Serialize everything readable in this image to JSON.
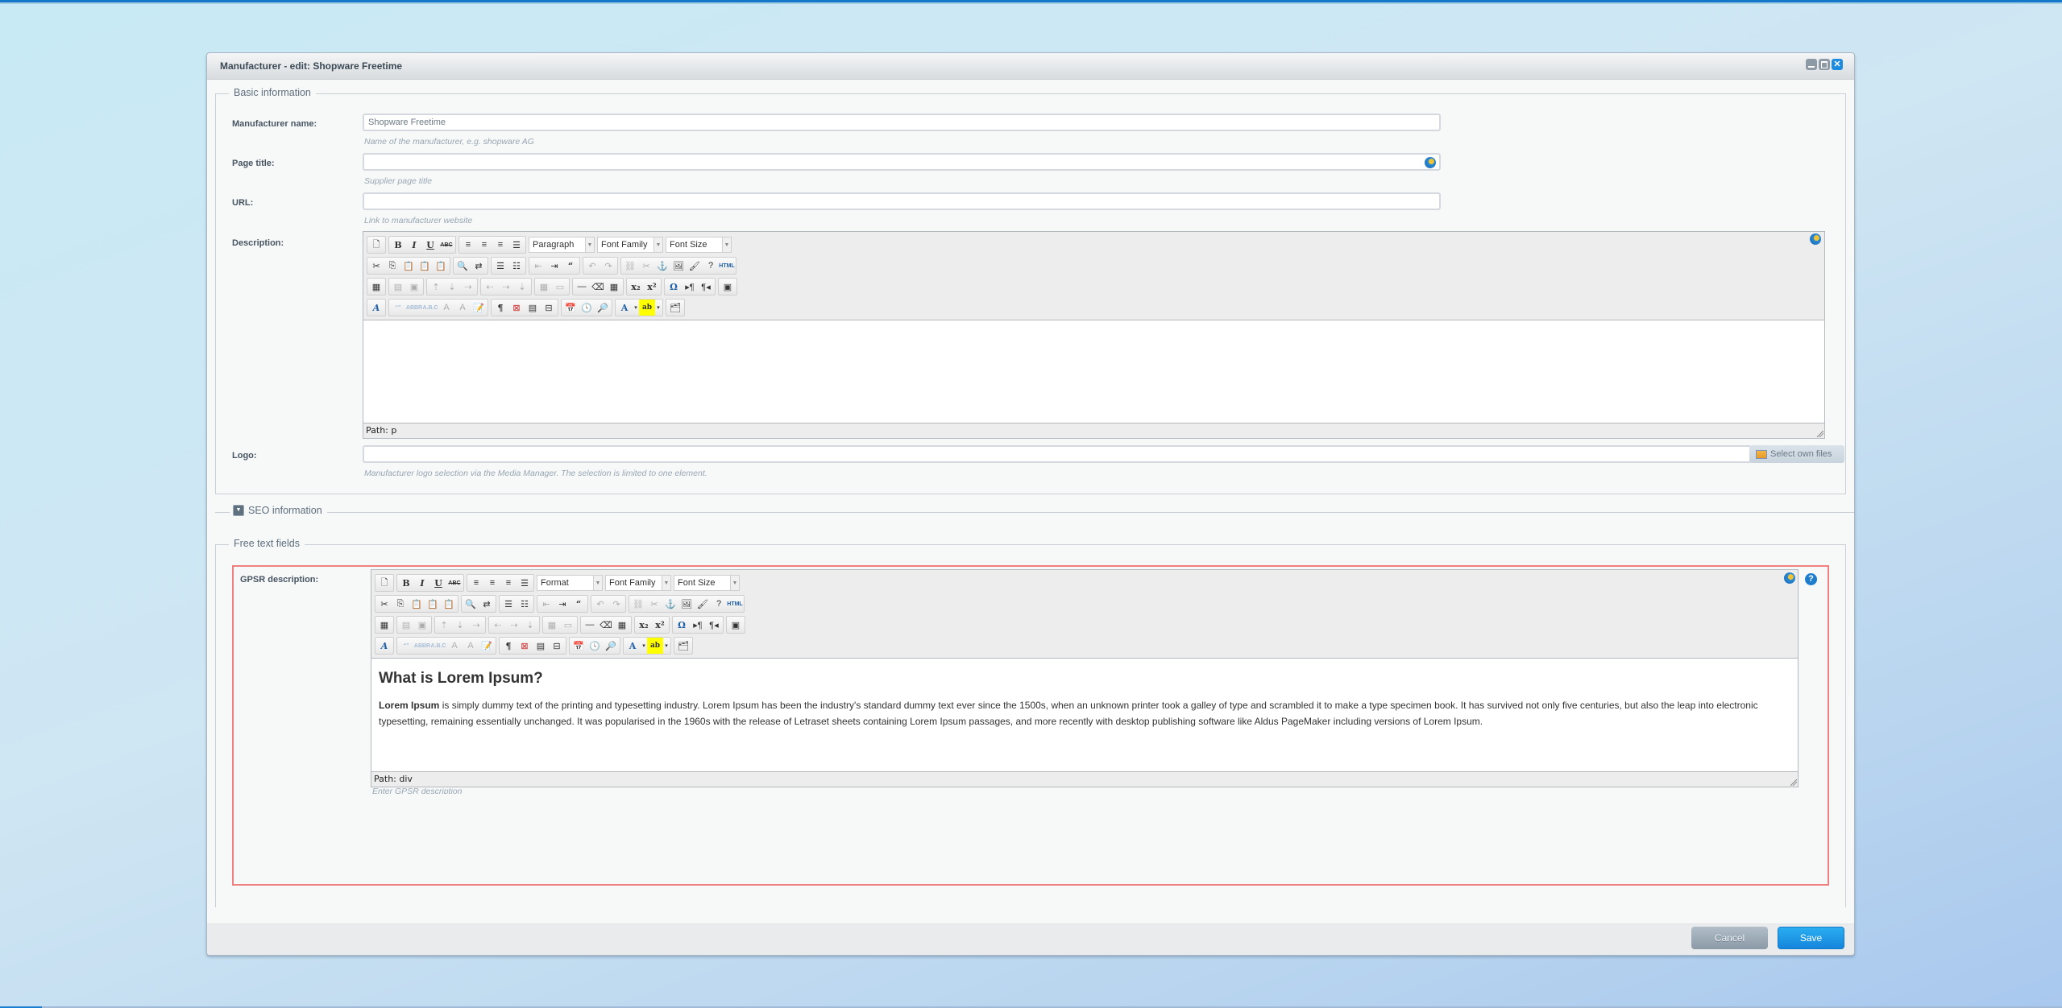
{
  "window": {
    "title": "Manufacturer - edit: Shopware Freetime",
    "tools": {
      "minimize": "minimize",
      "maximize": "maximize",
      "close": "close"
    }
  },
  "basic_info": {
    "legend": "Basic information",
    "manufacturer_name": {
      "label": "Manufacturer name:",
      "value": "Shopware Freetime",
      "hint": "Name of the manufacturer, e.g. shopware AG"
    },
    "page_title": {
      "label": "Page title:",
      "value": "",
      "hint": "Supplier page title"
    },
    "url": {
      "label": "URL:",
      "value": "",
      "hint": "Link to manufacturer website"
    },
    "description": {
      "label": "Description:",
      "block_format": "Paragraph",
      "font_family": "Font Family",
      "font_size": "Font Size",
      "path": "Path: p"
    },
    "logo": {
      "label": "Logo:",
      "value": "",
      "button": "Select own files",
      "hint": "Manufacturer logo selection via the Media Manager. The selection is limited to one element."
    }
  },
  "seo": {
    "legend": "SEO information"
  },
  "free_text": {
    "legend": "Free text fields",
    "gpsr": {
      "label": "GPSR description:",
      "block_format": "Format",
      "font_family": "Font Family",
      "font_size": "Font Size",
      "heading": "What is Lorem Ipsum?",
      "bold_lead": "Lorem Ipsum",
      "body": " is simply dummy text of the printing and typesetting industry. Lorem Ipsum has been the industry's standard dummy text ever since the 1500s, when an unknown printer took a galley of type and scrambled it to make a type specimen book. It has survived not only five centuries, but also the leap into electronic typesetting, remaining essentially unchanged. It was popularised in the 1960s with the release of Letraset sheets containing Lorem Ipsum passages, and more recently with desktop publishing software like Aldus PageMaker including versions of Lorem Ipsum.",
      "path": "Path: div",
      "hint": "Enter GPSR description"
    }
  },
  "footer": {
    "cancel": "Cancel",
    "save": "Save"
  },
  "colors": {
    "accent": "#1585dc",
    "error_border": "#f07f7f"
  }
}
